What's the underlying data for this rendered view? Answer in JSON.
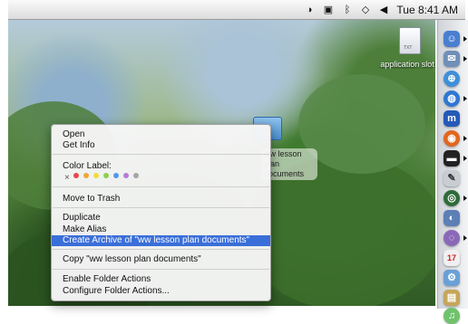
{
  "menubar": {
    "clock": "Tue 8:41 AM",
    "icons": [
      "time-machine-icon",
      "spaces-icon",
      "bluetooth-icon",
      "airport-icon",
      "volume-icon"
    ]
  },
  "desktop": {
    "file_label": "application slot",
    "file_tag": "TXT",
    "folder_label": "ww lesson plan documents"
  },
  "context_menu": {
    "items": [
      {
        "label": "Open"
      },
      {
        "label": "Get Info"
      },
      {
        "label": "Color Label:"
      },
      {
        "label": "Move to Trash"
      },
      {
        "label": "Duplicate"
      },
      {
        "label": "Make Alias"
      },
      {
        "label": "Create Archive of \"ww lesson plan documents\"",
        "highlighted": true
      },
      {
        "label": "Copy \"ww lesson plan documents\""
      },
      {
        "label": "Enable Folder Actions"
      },
      {
        "label": "Configure Folder Actions..."
      }
    ],
    "color_label_none": "×",
    "color_labels": [
      "#e8484a",
      "#f2a33a",
      "#f1dc3a",
      "#8ccf4c",
      "#4f9be8",
      "#b77bd6",
      "#a6a6a6"
    ]
  },
  "dock": {
    "icons": [
      "finder-icon",
      "mail-icon",
      "safari-icon",
      "ichat-icon",
      "word-icon",
      "firefox-icon",
      "terminal-icon",
      "preview-icon",
      "itunes-icon",
      "iphoto-icon",
      "ical-icon",
      "system-preferences-icon",
      "dictionary-icon",
      "itunes-dock-icon"
    ]
  }
}
